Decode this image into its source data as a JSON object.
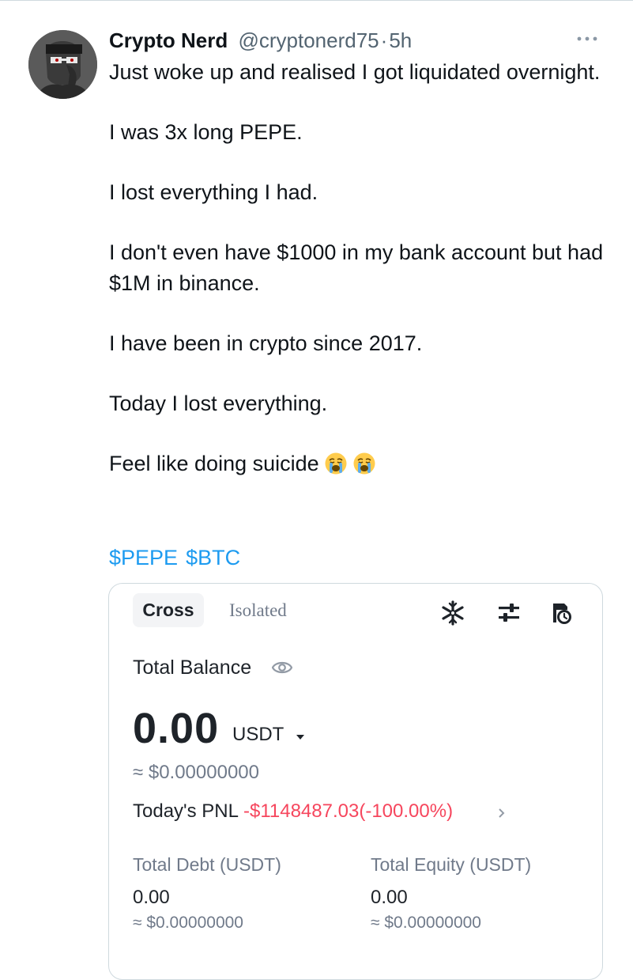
{
  "tweet": {
    "author_name": "Crypto Nerd",
    "author_handle": "@cryptonerd75",
    "separator": "·",
    "time": "5h",
    "more_icon": "more-horizontal-icon",
    "paragraphs": [
      "Just woke up and realised I got liquidated overnight.",
      "I was 3x long PEPE.",
      "I lost everything I had.",
      "I don't even have $1000 in my bank account but had $1M in binance.",
      "I have been in crypto since 2017.",
      "Today I lost everything."
    ],
    "last_line": "Feel like doing suicide",
    "emojis": [
      "crying-face-emoji",
      "crying-face-emoji"
    ],
    "cashtags": [
      "$PEPE",
      "$BTC"
    ],
    "link_color": "#1d9bf0"
  },
  "wallet": {
    "tabs": [
      "Cross",
      "Isolated"
    ],
    "active_tab": "Cross",
    "icons": [
      "snowflake-icon",
      "sliders-icon",
      "history-icon"
    ],
    "total_balance_label": "Total Balance",
    "balance": "0.00",
    "balance_unit": "USDT",
    "balance_fiat": "≈ $0.00000000",
    "pnl_label": "Today's PNL",
    "pnl_value": "-$1148487.03(-100.00%)",
    "pnl_color": "#f6465d",
    "debt_label": "Total Debt (USDT)",
    "debt_value": "0.00",
    "debt_fiat": "≈ $0.00000000",
    "equity_label": "Total Equity (USDT)",
    "equity_value": "0.00",
    "equity_fiat": "≈ $0.00000000"
  }
}
